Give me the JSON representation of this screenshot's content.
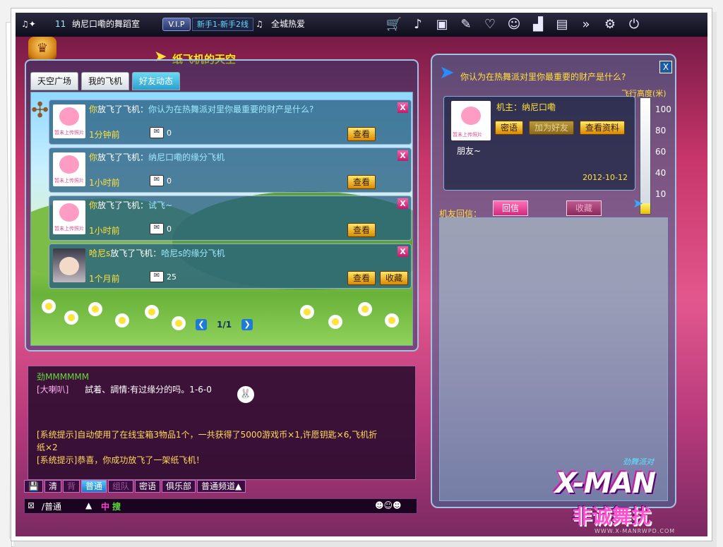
{
  "topbar": {
    "level": "11",
    "room_name": "纳尼口嘞的舞蹈室",
    "vip": "V.I.P",
    "route": "新手1-新手2线",
    "song": "全城热爱",
    "icons": [
      "cart-icon",
      "dance-icon",
      "gift-icon",
      "item-icon",
      "couple-icon",
      "friends-icon",
      "podium-icon",
      "notebook-icon",
      "forward-icon",
      "gear-icon",
      "power-icon"
    ]
  },
  "left_window": {
    "title": "纸飞机的天空",
    "tabs": [
      "天空广场",
      "我的飞机",
      "好友动态"
    ],
    "active_tab": 2,
    "messages": [
      {
        "who": "你",
        "action": "放飞了飞机：",
        "subject": "你认为在热舞派对里你最重要的财产是什么?",
        "time": "1分钟前",
        "count": "0",
        "buttons": [
          "查看"
        ],
        "avatar": "default"
      },
      {
        "who": "你",
        "action": "放飞了飞机：",
        "subject": "纳尼口嘞的缘分飞机",
        "time": "1小时前",
        "count": "0",
        "buttons": [
          "查看"
        ],
        "avatar": "default"
      },
      {
        "who": "你",
        "action": "放飞了飞机：",
        "subject": "试飞~",
        "time": "1小时前",
        "count": "0",
        "buttons": [
          "查看"
        ],
        "avatar": "default"
      },
      {
        "who": "哈尼s",
        "action": "放飞了飞机：",
        "subject": "哈尼s的缘分飞机",
        "time": "1个月前",
        "count": "25",
        "buttons": [
          "查看",
          "收藏"
        ],
        "avatar": "photo"
      }
    ],
    "close_label": "X",
    "avatar_caption": "暂未上传照片",
    "pager": {
      "prev": "❮",
      "current": "1/1",
      "next": "❯"
    }
  },
  "chat": {
    "lines": [
      {
        "kind": "nick",
        "text": "劲MMMMMM"
      },
      {
        "kind": "horn",
        "tag": "[大喇叭]",
        "text": "試着、調情:有过缘分的吗。1-6-0"
      },
      {
        "kind": "sys",
        "text": "[系统提示]自动使用了在线宝箱3物品1个，一共获得了5000游戏币×1,许愿钥匙×6,飞机折"
      },
      {
        "kind": "sys",
        "text": "纸×2"
      },
      {
        "kind": "sys",
        "text": "[系统提示]恭喜，你成功放飞了一架纸飞机！"
      }
    ],
    "emoji": "🐰",
    "channels": [
      "清",
      "背",
      "普通",
      "组队",
      "密语",
      "俱乐部",
      "普通频道▲"
    ],
    "active_channel": 2,
    "input": {
      "mode": "/普通",
      "mode_arrow": "▲",
      "font_size": "中",
      "search": "搜"
    }
  },
  "right_window": {
    "title": "你认为在热舞派对里你最重要的财产是什么?",
    "close_label": "X",
    "owner_label": "机主：",
    "owner_name": "纳尼口嘞",
    "owner_buttons": [
      "密语",
      "加为好友",
      "查看资料"
    ],
    "owner_friend": "朋友~",
    "date": "2012-10-12",
    "reply_button": "回信",
    "collect_button": "收藏",
    "height_label": "飞行高度(米)",
    "height_ticks": [
      "100",
      "80",
      "60",
      "40",
      "10"
    ],
    "height_value_m": 10,
    "reply_label": "机友回信："
  },
  "logo": {
    "en": "X-MAN",
    "cn": "非诚舞扰",
    "small": "劲舞派对"
  }
}
